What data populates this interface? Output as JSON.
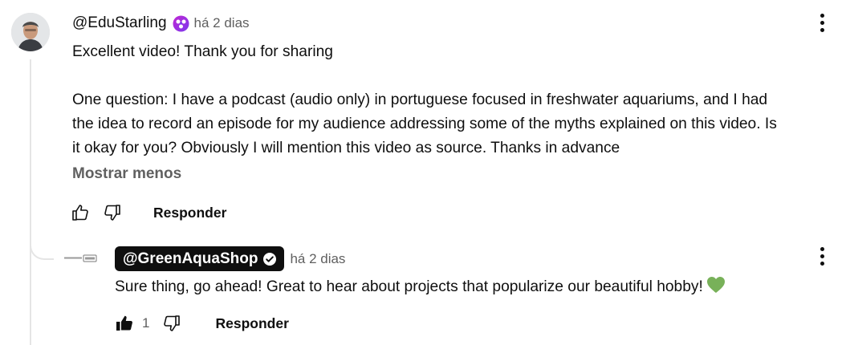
{
  "comment": {
    "author": "@EduStarling",
    "badge_icon": "member-badge-icon",
    "time": "há 2 dias",
    "paragraphs": [
      "Excellent video! Thank you for sharing",
      "One question: I have a podcast (audio only) in portuguese focused in freshwater aquariums, and I had",
      "the idea to record an episode for my audience addressing some of the myths explained on this video. Is",
      "it okay for you? Obviously I will mention this video as source. Thanks in advance"
    ],
    "show_less": "Mostrar menos",
    "reply_label": "Responder"
  },
  "reply": {
    "author": "@GreenAquaShop",
    "verified_icon": "verified-check-icon",
    "time": "há 2 dias",
    "text": "Sure thing, go ahead! Great to hear about projects that popularize our beautiful hobby!",
    "emoji": "green-heart-icon",
    "like_count": "1",
    "reply_label": "Responder"
  },
  "colors": {
    "text_primary": "#0f0f0f",
    "text_secondary": "#606060",
    "creator_pill_bg": "#0f0f0f",
    "heart_green": "#78b159",
    "badge_purple": "#a855f7"
  }
}
